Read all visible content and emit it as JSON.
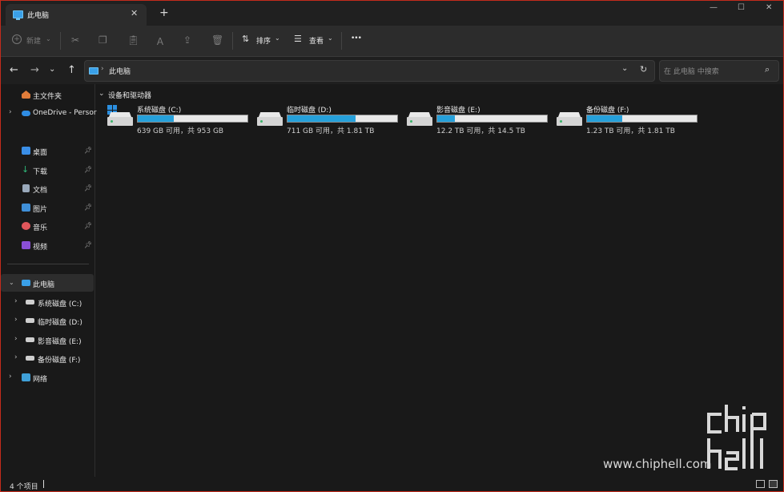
{
  "tab": {
    "title": "此电脑",
    "close": "✕",
    "new": "+"
  },
  "window": {
    "minimize": "—",
    "maximize": "☐",
    "close": "✕"
  },
  "toolbar": {
    "new_label": "新建",
    "sort_label": "排序",
    "view_label": "查看",
    "more": "•••"
  },
  "address": {
    "path": "此电脑",
    "search_placeholder": "在 此电脑 中搜索"
  },
  "sidebar": {
    "home": "主文件夹",
    "onedrive": "OneDrive - Persor",
    "quick": [
      {
        "label": "桌面",
        "icon": "desktop-icon",
        "color": "#3a8ee6"
      },
      {
        "label": "下载",
        "icon": "download-icon",
        "color": "#2fb87a"
      },
      {
        "label": "文档",
        "icon": "document-icon",
        "color": "#9aa9bb"
      },
      {
        "label": "图片",
        "icon": "pictures-icon",
        "color": "#3f8fd8"
      },
      {
        "label": "音乐",
        "icon": "music-icon",
        "color": "#e0565b"
      },
      {
        "label": "视频",
        "icon": "video-icon",
        "color": "#8a4fd6"
      }
    ],
    "this_pc": "此电脑",
    "drives": [
      "系统磁盘 (C:)",
      "临时磁盘 (D:)",
      "影音磁盘 (E:)",
      "备份磁盘 (F:)"
    ],
    "network": "网络"
  },
  "main": {
    "group_header": "设备和驱动器",
    "drives": [
      {
        "name": "系统磁盘 (C:)",
        "space": "639 GB 可用，共 953 GB",
        "used": 0.33,
        "system": true
      },
      {
        "name": "临时磁盘 (D:)",
        "space": "711 GB 可用，共 1.81 TB",
        "used": 0.62,
        "system": false
      },
      {
        "name": "影音磁盘 (E:)",
        "space": "12.2 TB 可用，共 14.5 TB",
        "used": 0.16,
        "system": false
      },
      {
        "name": "备份磁盘 (F:)",
        "space": "1.23 TB 可用，共 1.81 TB",
        "used": 0.32,
        "system": false
      }
    ]
  },
  "status": {
    "count": "4 个项目"
  },
  "watermark": {
    "site": "www.chiphell.com"
  },
  "colors": {
    "accent": "#26a0da",
    "border": "#c42b1c"
  }
}
